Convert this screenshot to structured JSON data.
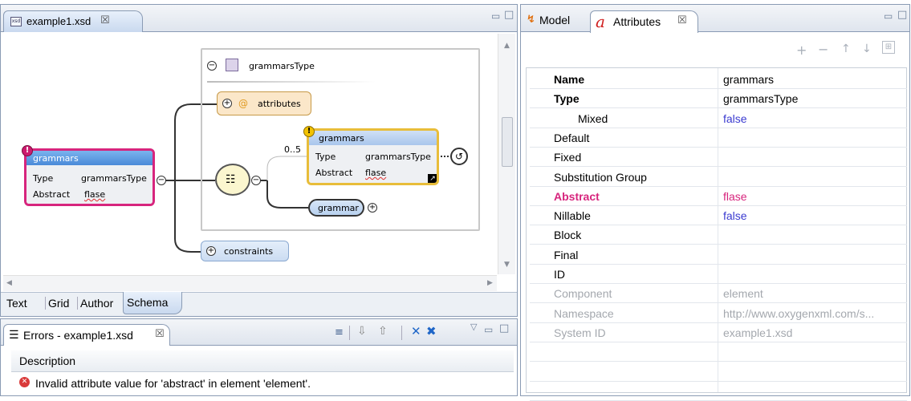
{
  "editor": {
    "tab_title": "example1.xsd",
    "tab_close": "☒",
    "ctl_min": "▭",
    "ctl_max": "□",
    "bottom_tabs": [
      "Text",
      "Grid",
      "Author",
      "Schema"
    ],
    "diagram": {
      "root": {
        "name": "grammars",
        "type_label": "Type",
        "type_value": "grammarsType",
        "abstract_label": "Abstract",
        "abstract_value": "flase"
      },
      "container_title": "grammarsType",
      "attributes_label": "attributes",
      "attributes_at": "@",
      "occurrence": "0..5",
      "ref": {
        "name": "grammars",
        "type_label": "Type",
        "type_value": "grammarsType",
        "abstract_label": "Abstract",
        "abstract_value": "flase"
      },
      "grammar_label": "grammar",
      "constraints_label": "constraints"
    }
  },
  "errors": {
    "tab_title": "Errors - example1.xsd",
    "tab_close": "☒",
    "column_header": "Description",
    "row_text": "Invalid attribute value for 'abstract' in element 'element'.",
    "toolbar_icons": [
      "tree-icon",
      "arrow-down-icon",
      "arrow-up-icon",
      "remove-icon",
      "remove-all-icon"
    ]
  },
  "side": {
    "tab_model": "Model",
    "tab_attributes": "Attributes",
    "tab_close": "☒",
    "toolbar": {
      "add": "+",
      "remove": "−",
      "up": "↑",
      "down": "↓"
    },
    "properties": [
      {
        "name": "Name",
        "value": "grammars",
        "bold": true,
        "style": "normal"
      },
      {
        "name": "Type",
        "value": "grammarsType",
        "bold": true,
        "style": "normal"
      },
      {
        "name": "Mixed",
        "value": "false",
        "bold": false,
        "style": "default",
        "indent": true
      },
      {
        "name": "Default",
        "value": "",
        "bold": false,
        "style": "normal"
      },
      {
        "name": "Fixed",
        "value": "",
        "bold": false,
        "style": "normal"
      },
      {
        "name": "Substitution Group",
        "value": "",
        "bold": false,
        "style": "normal"
      },
      {
        "name": "Abstract",
        "value": "flase",
        "bold": true,
        "style": "error"
      },
      {
        "name": "Nillable",
        "value": "false",
        "bold": false,
        "style": "default"
      },
      {
        "name": "Block",
        "value": "",
        "bold": false,
        "style": "normal"
      },
      {
        "name": "Final",
        "value": "",
        "bold": false,
        "style": "normal"
      },
      {
        "name": "ID",
        "value": "",
        "bold": false,
        "style": "normal"
      },
      {
        "name": "Component",
        "value": "element",
        "bold": false,
        "style": "readonly"
      },
      {
        "name": "Namespace",
        "value": "http://www.oxygenxml.com/s...",
        "bold": false,
        "style": "readonly"
      },
      {
        "name": "System ID",
        "value": "example1.xsd",
        "bold": false,
        "style": "readonly"
      }
    ]
  },
  "colors": {
    "root_border": "#d7257d",
    "ref_border": "#e8bd3a",
    "header_blue": "#5a9ae0",
    "error_value": "#d7257d",
    "default_value": "#3a3ad0",
    "readonly": "#a4a8ae"
  }
}
